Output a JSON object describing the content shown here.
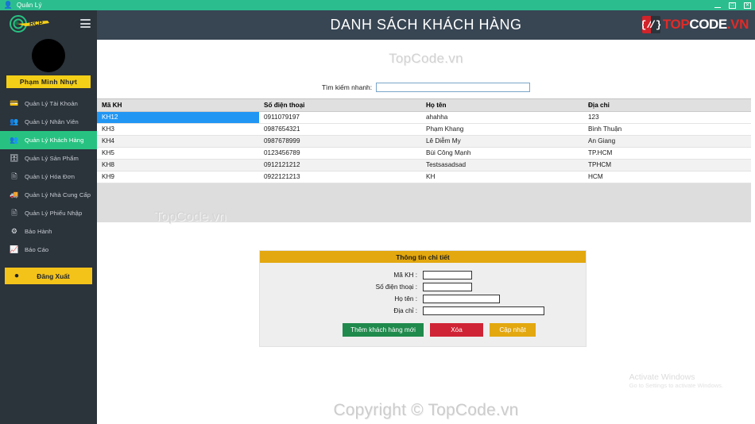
{
  "window": {
    "title": "Quản Lý",
    "app_icon": "person-icon",
    "controls": [
      {
        "name": "minimize-button",
        "glyph": "minimize-icon"
      },
      {
        "name": "maximize-button",
        "glyph": "maximize-icon"
      },
      {
        "name": "close-button",
        "glyph": "close-icon"
      }
    ]
  },
  "sidebar": {
    "logo_text": "RCP",
    "menu_toggle": "hamburger-icon",
    "user_name": "Phạm Minh Nhựt",
    "items": [
      {
        "label": "Quản Lý Tài Khoản",
        "icon": "id-card-icon",
        "active": false
      },
      {
        "label": "Quản Lý Nhân Viên",
        "icon": "users-icon",
        "active": false
      },
      {
        "label": "Quản Lý Khách Hàng",
        "icon": "users-icon",
        "active": true
      },
      {
        "label": "Quản Lý Sản Phẩm",
        "icon": "box-icon",
        "active": false
      },
      {
        "label": "Quản Lý Hóa Đơn",
        "icon": "invoice-icon",
        "active": false
      },
      {
        "label": "Quản Lý Nhà Cung Cấp",
        "icon": "truck-icon",
        "active": false
      },
      {
        "label": "Quản Lý Phiếu Nhập",
        "icon": "document-icon",
        "active": false
      },
      {
        "label": "Bảo Hành",
        "icon": "shield-icon",
        "active": false
      },
      {
        "label": "Báo Cáo",
        "icon": "chart-icon",
        "active": false
      }
    ],
    "logout": {
      "label": "Đăng Xuất",
      "icon": "power-icon"
    }
  },
  "header": {
    "title": "DANH SÁCH KHÁCH HÀNG",
    "brand": {
      "part1": "TOP",
      "part2": "CODE",
      "part3": ".VN",
      "mark_left": "{/",
      "mark_right": "/}"
    }
  },
  "watermarks": {
    "top": "TopCode.vn",
    "table": "TopCode.vn",
    "copyright": "Copyright © TopCode.vn",
    "activate_title": "Activate Windows",
    "activate_sub": "Go to Settings to activate Windows."
  },
  "search": {
    "label": "Tìm kiếm nhanh:",
    "value": "",
    "placeholder": ""
  },
  "table": {
    "columns": [
      "Mã KH",
      "Số điện thoại",
      "Họ tên",
      "Địa chỉ"
    ],
    "selected_row_index": 0,
    "rows": [
      {
        "ma_kh": "KH12",
        "sdt": "0911079197",
        "ho_ten": "ahahha",
        "dia_chi": "123"
      },
      {
        "ma_kh": "KH3",
        "sdt": "0987654321",
        "ho_ten": "Phạm Khang",
        "dia_chi": "Bình Thuận"
      },
      {
        "ma_kh": "KH4",
        "sdt": "0987678999",
        "ho_ten": "Lê Diễm My",
        "dia_chi": "An Giang"
      },
      {
        "ma_kh": "KH5",
        "sdt": "0123456789",
        "ho_ten": "Bùi Công Mạnh",
        "dia_chi": "TP.HCM"
      },
      {
        "ma_kh": "KH8",
        "sdt": "0912121212",
        "ho_ten": "Testsasadsad",
        "dia_chi": "TPHCM"
      },
      {
        "ma_kh": "KH9",
        "sdt": "0922121213",
        "ho_ten": "KH",
        "dia_chi": "HCM"
      }
    ]
  },
  "detail": {
    "title": "Thông tin chi tiết",
    "fields": [
      {
        "label": "Mã KH :",
        "value": "",
        "size": "sm"
      },
      {
        "label": "Số điện thoại :",
        "value": "",
        "size": "sm"
      },
      {
        "label": "Họ tên :",
        "value": "",
        "size": "md"
      },
      {
        "label": "Địa chỉ :",
        "value": "",
        "size": "lg"
      }
    ],
    "buttons": {
      "add": "Thêm khách hàng mới",
      "delete": "Xóa",
      "update": "Cập nhật"
    }
  },
  "colors": {
    "titlebar": "#2cbd8e",
    "sidebar": "#2b333b",
    "sidebar_active": "#27c281",
    "header": "#384553",
    "accent_yellow": "#f4c31a",
    "panel_header": "#e3a80f",
    "row_selected": "#2196f3",
    "btn_add": "#1f8a4c",
    "btn_delete": "#cf2435"
  }
}
